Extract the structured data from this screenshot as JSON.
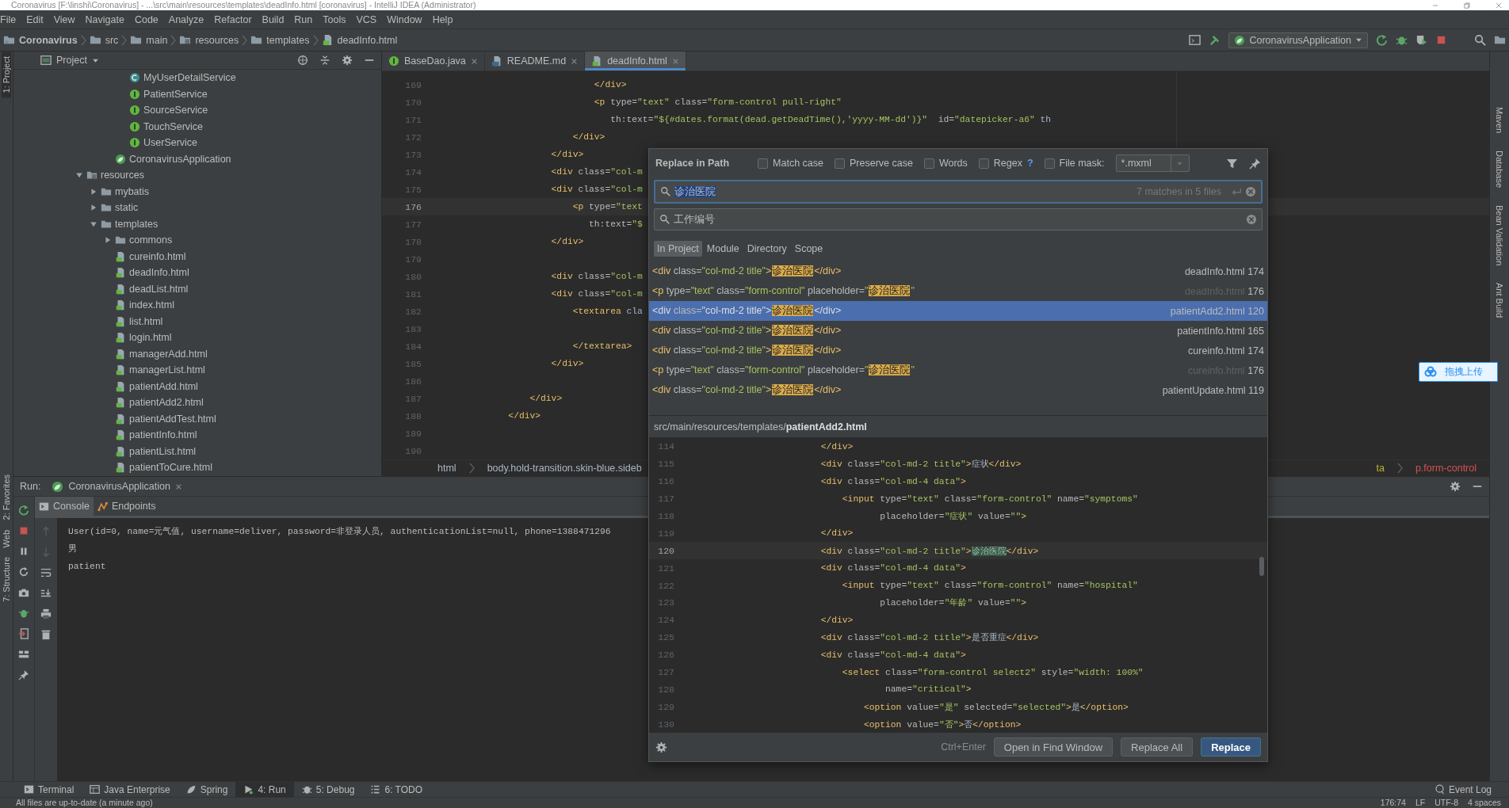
{
  "window": {
    "title": "Coronavirus [F:\\linshi\\Coronavirus] - ...\\src\\main\\resources\\templates\\deadInfo.html [coronavirus] - IntelliJ IDEA (Administrator)"
  },
  "menu": [
    "File",
    "Edit",
    "View",
    "Navigate",
    "Code",
    "Analyze",
    "Refactor",
    "Build",
    "Run",
    "Tools",
    "VCS",
    "Window",
    "Help"
  ],
  "breadcrumb": [
    {
      "label": "Coronavirus",
      "kind": "project"
    },
    {
      "label": "src",
      "kind": "folder"
    },
    {
      "label": "main",
      "kind": "folder"
    },
    {
      "label": "resources",
      "kind": "resources"
    },
    {
      "label": "templates",
      "kind": "folder"
    },
    {
      "label": "deadInfo.html",
      "kind": "html"
    }
  ],
  "run_config": "CoronavirusApplication",
  "left_stripe": [
    "1: Project",
    "2: Favorites",
    "Web",
    "7: Structure"
  ],
  "right_stripe": [
    "Maven",
    "Database",
    "Bean Validation",
    "Ant Build"
  ],
  "project_panel": {
    "title": "Project",
    "tree": [
      {
        "children": [
          {
            "children": [
              {
                "children": [
                  {
                    "name": "MyUserDetailService",
                    "kind": "class"
                  },
                  {
                    "name": "PatientService",
                    "kind": "interface"
                  },
                  {
                    "name": "SourceService",
                    "kind": "interface"
                  },
                  {
                    "name": "TouchService",
                    "kind": "interface"
                  },
                  {
                    "name": "UserService",
                    "kind": "interface"
                  }
                ]
              },
              {
                "name": "CoronavirusApplication",
                "kind": "app"
              }
            ]
          }
        ]
      },
      {
        "name": "resources",
        "kind": "resources",
        "expanded": true,
        "children": [
          {
            "name": "mybatis",
            "kind": "folder",
            "expanded": false
          },
          {
            "name": "static",
            "kind": "folder",
            "expanded": false
          },
          {
            "name": "templates",
            "kind": "folder",
            "expanded": true,
            "children": [
              {
                "name": "commons",
                "kind": "folder",
                "expanded": false
              },
              {
                "name": "cureinfo.html",
                "kind": "html"
              },
              {
                "name": "deadInfo.html",
                "kind": "html"
              },
              {
                "name": "deadList.html",
                "kind": "html"
              },
              {
                "name": "index.html",
                "kind": "html"
              },
              {
                "name": "list.html",
                "kind": "html"
              },
              {
                "name": "login.html",
                "kind": "html"
              },
              {
                "name": "managerAdd.html",
                "kind": "html"
              },
              {
                "name": "managerList.html",
                "kind": "html"
              },
              {
                "name": "patientAdd.html",
                "kind": "html"
              },
              {
                "name": "patientAdd2.html",
                "kind": "html"
              },
              {
                "name": "patientAddTest.html",
                "kind": "html"
              },
              {
                "name": "patientInfo.html",
                "kind": "html"
              },
              {
                "name": "patientList.html",
                "kind": "html"
              },
              {
                "name": "patientToCure.html",
                "kind": "html"
              }
            ]
          }
        ]
      }
    ]
  },
  "editor": {
    "tabs": [
      {
        "label": "BaseDao.java",
        "kind": "interface",
        "selected": false
      },
      {
        "label": "README.md",
        "kind": "markdown",
        "selected": false
      },
      {
        "label": "deadInfo.html",
        "kind": "html",
        "selected": true
      }
    ],
    "lines": [
      {
        "num": "169",
        "text": "                            </div>"
      },
      {
        "num": "170",
        "text": "                            <p type=\"text\" class=\"form-control pull-right\""
      },
      {
        "num": "171",
        "text": "                               th:text=\"${#dates.format(dead.getDeadTime(),'yyyy-MM-dd')}\"  id=\"datepicker-a6\" th"
      },
      {
        "num": "172",
        "text": "                        </div>"
      },
      {
        "num": "173",
        "text": "                    </div>"
      },
      {
        "num": "174",
        "text": "                    <div class=\"col-m"
      },
      {
        "num": "175",
        "text": "                    <div class=\"col-m"
      },
      {
        "num": "176",
        "text": "                        <p type=\"text",
        "current": true
      },
      {
        "num": "177",
        "text": "                           th:text=\"$"
      },
      {
        "num": "178",
        "text": "                    </div>"
      },
      {
        "num": "179"
      },
      {
        "num": "180",
        "text": "                    <div class=\"col-m"
      },
      {
        "num": "181",
        "text": "                    <div class=\"col-m"
      },
      {
        "num": "182",
        "text": "                        <textarea cla"
      },
      {
        "num": "183"
      },
      {
        "num": "184",
        "text": "                        </textarea>"
      },
      {
        "num": "185",
        "text": "                    </div>"
      },
      {
        "num": "186"
      },
      {
        "num": "187",
        "text": "                </div>"
      },
      {
        "num": "188",
        "text": "            </div>"
      },
      {
        "num": "189"
      },
      {
        "num": "190"
      }
    ],
    "crumbs_left": [
      "html",
      "body.hold-transition.skin-blue.sideb"
    ],
    "crumbs_right": [
      "ta",
      "p.form-control"
    ]
  },
  "run": {
    "label": "Run:",
    "config": "CoronavirusApplication",
    "tabs": [
      {
        "label": "Console",
        "kind": "console",
        "selected": true
      },
      {
        "label": "Endpoints",
        "kind": "endpoints",
        "selected": false
      }
    ],
    "output": [
      "User(id=0, name=元气值, username=deliver, password=非登录人员, authenticationList=null, phone=1388471296",
      "男",
      "patient"
    ]
  },
  "tool_tabs": [
    {
      "label": "Terminal",
      "kind": "terminal",
      "selected": false
    },
    {
      "label": "Java Enterprise",
      "kind": "enterprise",
      "selected": false
    },
    {
      "label": "Spring",
      "kind": "spring",
      "selected": false
    },
    {
      "label": "4: Run",
      "kind": "run",
      "selected": true
    },
    {
      "label": "5: Debug",
      "kind": "debug",
      "selected": false
    },
    {
      "label": "6: TODO",
      "kind": "todo",
      "selected": false
    }
  ],
  "event_log": "Event Log",
  "status_bar": {
    "message": "All files are up-to-date (a minute ago)",
    "items": [
      "176:74",
      "LF",
      "UTF-8",
      "4 spaces"
    ]
  },
  "upload_widget": {
    "label": "拖拽上传"
  },
  "dialog": {
    "title": "Replace in Path",
    "options": [
      {
        "label": "Match case",
        "checked": false
      },
      {
        "label": "Preserve case",
        "checked": false
      },
      {
        "label": "Words",
        "checked": false
      },
      {
        "label": "Regex",
        "checked": false,
        "help": "?"
      },
      {
        "label": "File mask:",
        "checked": false
      }
    ],
    "file_mask": "*.mxml",
    "search": {
      "value": "诊治医院",
      "matches": "7 matches in 5 files"
    },
    "replace": {
      "value": "工作编号"
    },
    "scopes": [
      {
        "label": "In Project",
        "selected": true
      },
      {
        "label": "Module",
        "selected": false
      },
      {
        "label": "Directory",
        "selected": false
      },
      {
        "label": "Scope",
        "selected": false
      }
    ],
    "results": [
      {
        "before": "<div class=\"col-md-2 title\">",
        "match": "诊治医院",
        "after": "</div>",
        "file": "deadInfo.html",
        "line": "174",
        "dimmed": false,
        "selected": false
      },
      {
        "before": "<p type=\"text\" class=\"form-control\" placeholder=\"",
        "match": "诊治医院",
        "after": "\"",
        "file": "deadInfo.html",
        "line": "176",
        "dimmed": true,
        "selected": false
      },
      {
        "before": "<div class=\"col-md-2 title\">",
        "match": "诊治医院",
        "after": "</div>",
        "file": "patientAdd2.html",
        "line": "120",
        "dimmed": false,
        "selected": true
      },
      {
        "before": "<div class=\"col-md-2 title\">",
        "match": "诊治医院",
        "after": "</div>",
        "file": "patientInfo.html",
        "line": "165",
        "dimmed": false,
        "selected": false
      },
      {
        "before": "<div class=\"col-md-2 title\">",
        "match": "诊治医院",
        "after": "</div>",
        "file": "cureinfo.html",
        "line": "174",
        "dimmed": false,
        "selected": false
      },
      {
        "before": "<p type=\"text\" class=\"form-control\" placeholder=\"",
        "match": "诊治医院",
        "after": "\"",
        "file": "cureinfo.html",
        "line": "176",
        "dimmed": true,
        "selected": false
      },
      {
        "before": "<div class=\"col-md-2 title\">",
        "match": "诊治医院",
        "after": "</div>",
        "file": "patientUpdate.html",
        "line": "119",
        "dimmed": false,
        "selected": false
      }
    ],
    "preview": {
      "path": "src/main/resources/templates/**patientAdd2.html**",
      "lines": [
        {
          "num": "114",
          "text": "                        </div>"
        },
        {
          "num": "115",
          "text": "                        <div class=\"col-md-2 title\">症状</div>"
        },
        {
          "num": "116",
          "text": "                        <div class=\"col-md-4 data\">"
        },
        {
          "num": "117",
          "text": "                            <input type=\"text\" class=\"form-control\" name=\"symptoms\""
        },
        {
          "num": "118",
          "text": "                                   placeholder=\"症状\" value=\"\">"
        },
        {
          "num": "119",
          "text": "                        </div>"
        },
        {
          "num": "120",
          "text": "                        <div class=\"col-md-2 title\">",
          "match": "诊治医院",
          "after": "</div>",
          "current": true
        },
        {
          "num": "121",
          "text": "                        <div class=\"col-md-4 data\">"
        },
        {
          "num": "122",
          "text": "                            <input type=\"text\" class=\"form-control\" name=\"hospital\""
        },
        {
          "num": "123",
          "text": "                                   placeholder=\"年龄\" value=\"\">"
        },
        {
          "num": "124",
          "text": "                        </div>"
        },
        {
          "num": "125",
          "text": "                        <div class=\"col-md-2 title\">是否重症</div>"
        },
        {
          "num": "126",
          "text": "                        <div class=\"col-md-4 data\">"
        },
        {
          "num": "127",
          "text": "                            <select class=\"form-control select2\" style=\"width: 100%\""
        },
        {
          "num": "128",
          "text": "                                    name=\"critical\">"
        },
        {
          "num": "129",
          "text": "                                <option value=\"是\" selected=\"selected\">是</option>"
        },
        {
          "num": "130",
          "text": "                                <option value=\"否\">否</option>"
        }
      ]
    },
    "shortcut": "Ctrl+Enter",
    "buttons": [
      {
        "label": "Open in Find Window",
        "primary": false
      },
      {
        "label": "Replace All",
        "primary": false
      },
      {
        "label": "Replace",
        "primary": true
      }
    ]
  }
}
